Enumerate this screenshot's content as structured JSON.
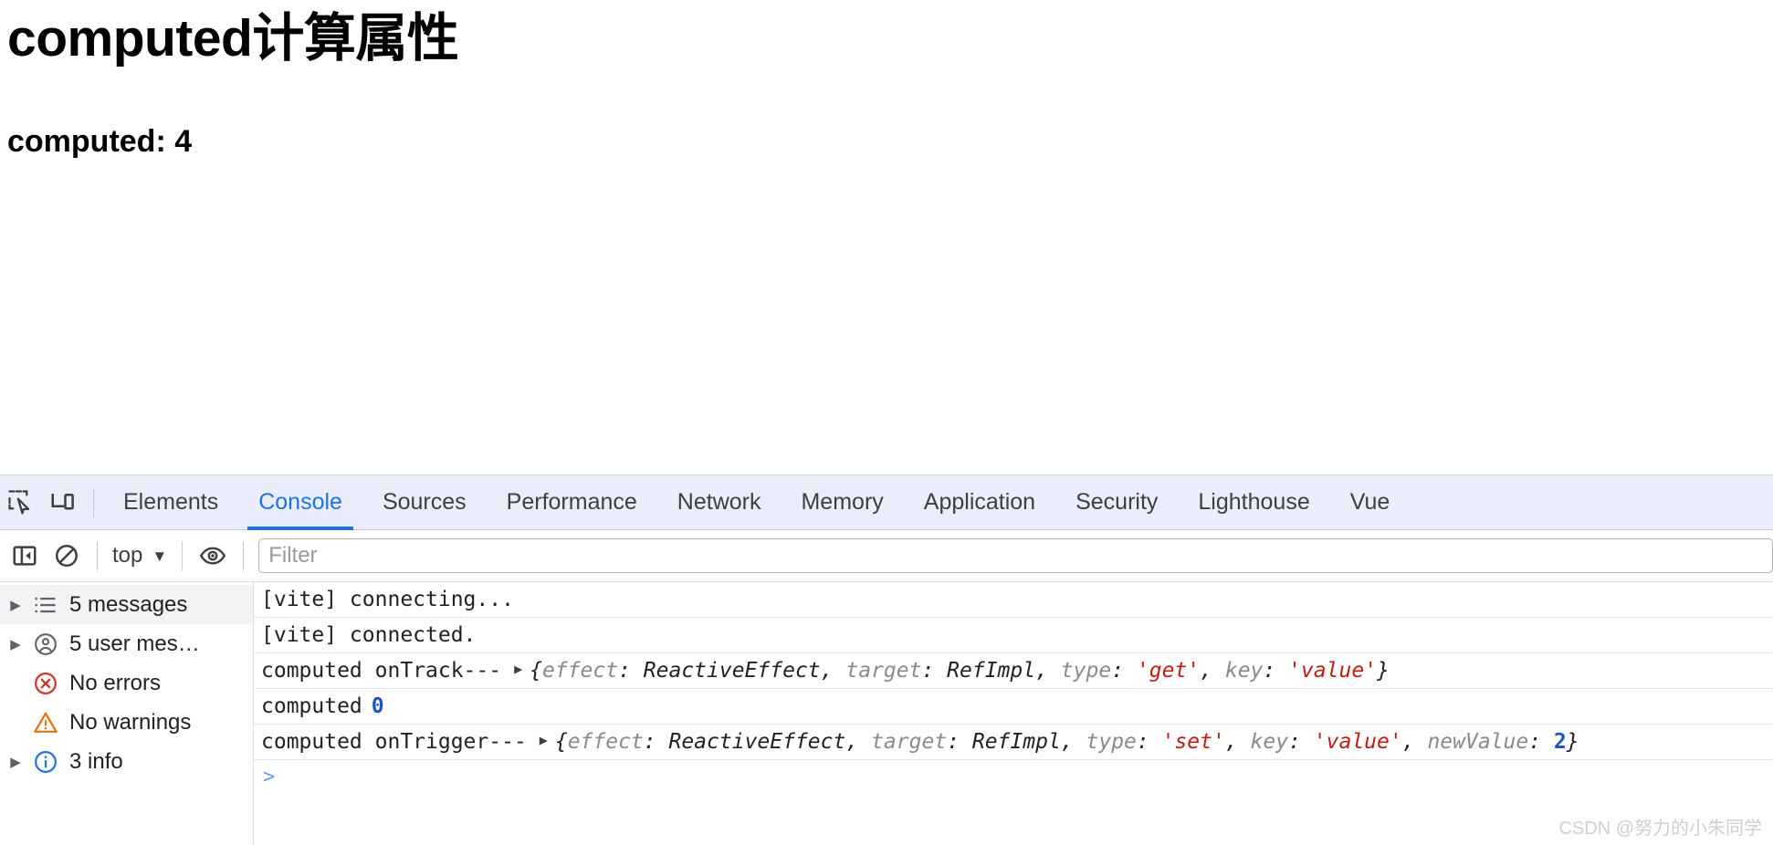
{
  "page": {
    "title": "computed计算属性",
    "subtitle": "computed: 4"
  },
  "devtools": {
    "icons": {
      "inspect": "inspect-element-icon",
      "device": "device-toolbar-icon",
      "sidebar_toggle": "console-sidebar-toggle-icon",
      "clear": "clear-console-icon",
      "eye": "live-expression-eye-icon"
    },
    "tabs": [
      {
        "label": "Elements",
        "selected": false
      },
      {
        "label": "Console",
        "selected": true
      },
      {
        "label": "Sources",
        "selected": false
      },
      {
        "label": "Performance",
        "selected": false
      },
      {
        "label": "Network",
        "selected": false
      },
      {
        "label": "Memory",
        "selected": false
      },
      {
        "label": "Application",
        "selected": false
      },
      {
        "label": "Security",
        "selected": false
      },
      {
        "label": "Lighthouse",
        "selected": false
      },
      {
        "label": "Vue",
        "selected": false
      }
    ],
    "toolbar": {
      "context": "top",
      "filter_placeholder": "Filter",
      "filter_value": ""
    },
    "sidebar": [
      {
        "label": "5 messages",
        "icon": "list-icon",
        "arrow": true,
        "selected": true
      },
      {
        "label": "5 user mes…",
        "icon": "user-icon",
        "arrow": true,
        "selected": false
      },
      {
        "label": "No errors",
        "icon": "error-icon",
        "arrow": false,
        "selected": false
      },
      {
        "label": "No warnings",
        "icon": "warning-icon",
        "arrow": false,
        "selected": false
      },
      {
        "label": "3 info",
        "icon": "info-icon",
        "arrow": true,
        "selected": false
      }
    ],
    "logs": [
      {
        "text": "[vite] connecting...",
        "expandable": false,
        "object": null
      },
      {
        "text": "[vite] connected.",
        "expandable": false,
        "object": null
      },
      {
        "text": "computed onTrack---",
        "expandable": true,
        "object": {
          "open": "{",
          "close": "}",
          "props": [
            {
              "key": "effect",
              "value": "ReactiveEffect",
              "kind": "class"
            },
            {
              "key": "target",
              "value": "RefImpl",
              "kind": "class"
            },
            {
              "key": "type",
              "value": "'get'",
              "kind": "string"
            },
            {
              "key": "key",
              "value": "'value'",
              "kind": "string"
            }
          ]
        }
      },
      {
        "text": "computed",
        "expandable": false,
        "number": "0",
        "object": null
      },
      {
        "text": "computed onTrigger---",
        "expandable": true,
        "object": {
          "open": "{",
          "close": "}",
          "props": [
            {
              "key": "effect",
              "value": "ReactiveEffect",
              "kind": "class"
            },
            {
              "key": "target",
              "value": "RefImpl",
              "kind": "class"
            },
            {
              "key": "type",
              "value": "'set'",
              "kind": "string"
            },
            {
              "key": "key",
              "value": "'value'",
              "kind": "string"
            },
            {
              "key": "newValue",
              "value": "2",
              "kind": "number"
            }
          ]
        }
      }
    ],
    "prompt_symbol": ">"
  },
  "watermark": "CSDN @努力的小朱同学",
  "colors": {
    "accent": "#1a73e8",
    "tabstrip_bg": "#ebeefa",
    "string": "#c41a16",
    "number": "#1a56c4",
    "error": "#d93025",
    "warning": "#e8710a",
    "info": "#1a73e8"
  }
}
